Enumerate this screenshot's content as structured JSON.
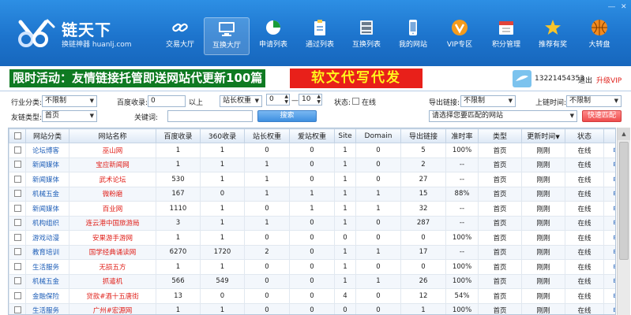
{
  "window": {
    "title": "链天下",
    "subtitle": "换链神器 huanlj.com",
    "minimize": "—",
    "close": "✕"
  },
  "nav": [
    {
      "label": "交易大厅",
      "icon": "link-chain-icon"
    },
    {
      "label": "互换大厅",
      "icon": "monitor-icon"
    },
    {
      "label": "申请列表",
      "icon": "pie-chart-icon"
    },
    {
      "label": "通过列表",
      "icon": "clipboard-icon"
    },
    {
      "label": "互换列表",
      "icon": "server-icon"
    },
    {
      "label": "我的网站",
      "icon": "phone-icon"
    },
    {
      "label": "VIP专区",
      "icon": "vip-icon"
    },
    {
      "label": "积分管理",
      "icon": "calendar-icon"
    },
    {
      "label": "推荐有奖",
      "icon": "star-icon"
    },
    {
      "label": "大转盘",
      "icon": "basketball-icon"
    }
  ],
  "banner": {
    "promo": "限时活动：友情链接托管即送网站代更新100篇",
    "ad": "软文代写代发",
    "phone": "13221454353",
    "logout": "退出",
    "vip": "升级VIP"
  },
  "filters": {
    "industry_label": "行业分类:",
    "industry_value": "不限制",
    "baidu_label": "百度收录:",
    "baidu_value": "0",
    "above_label": "以上",
    "weight_select": "站长权重",
    "weight_min": "0",
    "weight_dash": "—",
    "weight_max": "10",
    "status_label": "状态:",
    "online_label": "在线",
    "export_label": "导出链接:",
    "export_value": "不限制",
    "time_label": "上链时间:",
    "time_value": "不限制",
    "type_label": "友链类型:",
    "type_value": "首页",
    "keyword_label": "关键词:",
    "keyword_value": "",
    "search_button": "搜索",
    "site_placeholder": "请选择您要匹配的网站",
    "match_button": "快速匹配"
  },
  "table": {
    "headers": [
      "网站分类",
      "网站名称",
      "百度收录",
      "360收录",
      "站长权重",
      "爱站权重",
      "Site",
      "Domain",
      "导出链接",
      "准时率",
      "类型",
      "更新时间",
      "状态",
      "操作"
    ],
    "rows": [
      [
        "论坛博客",
        "巫山网",
        "1",
        "1",
        "0",
        "0",
        "1",
        "0",
        "5",
        "100%",
        "首页",
        "刚刚",
        "在线",
        "申请交换"
      ],
      [
        "新闻媒体",
        "宝应新闻网",
        "1",
        "1",
        "1",
        "0",
        "1",
        "0",
        "2",
        "--",
        "首页",
        "刚刚",
        "在线",
        "申请交换"
      ],
      [
        "新闻媒体",
        "武术论坛",
        "530",
        "1",
        "1",
        "0",
        "1",
        "0",
        "27",
        "--",
        "首页",
        "刚刚",
        "在线",
        "申请交换"
      ],
      [
        "机械五金",
        "微粉磨",
        "167",
        "0",
        "1",
        "1",
        "1",
        "1",
        "15",
        "88%",
        "首页",
        "刚刚",
        "在线",
        "申请交换"
      ],
      [
        "新闻媒体",
        "百业网",
        "1110",
        "1",
        "0",
        "1",
        "1",
        "1",
        "32",
        "--",
        "首页",
        "刚刚",
        "在线",
        "申请交换"
      ],
      [
        "机构组织",
        "连云港中国旅游局",
        "3",
        "1",
        "1",
        "0",
        "1",
        "0",
        "287",
        "--",
        "首页",
        "刚刚",
        "在线",
        "申请交换"
      ],
      [
        "游戏动漫",
        "安果游手游网",
        "1",
        "1",
        "0",
        "0",
        "0",
        "0",
        "0",
        "100%",
        "首页",
        "刚刚",
        "在线",
        "申请交换"
      ],
      [
        "教育培训",
        "国学经典诵读网",
        "6270",
        "1720",
        "2",
        "0",
        "1",
        "1",
        "17",
        "--",
        "首页",
        "刚刚",
        "在线",
        "申请交换"
      ],
      [
        "生活服务",
        "无损五方",
        "1",
        "1",
        "0",
        "0",
        "1",
        "0",
        "0",
        "100%",
        "首页",
        "刚刚",
        "在线",
        "申请交换"
      ],
      [
        "机械五金",
        "抓遣机",
        "566",
        "549",
        "0",
        "0",
        "1",
        "1",
        "26",
        "100%",
        "首页",
        "刚刚",
        "在线",
        "申请交换"
      ],
      [
        "金融保险",
        "贷款#酒十五唐街",
        "13",
        "0",
        "0",
        "0",
        "4",
        "0",
        "12",
        "54%",
        "首页",
        "刚刚",
        "在线",
        "申请交换"
      ],
      [
        "生活服务",
        "广州#宏源网",
        "1",
        "1",
        "0",
        "0",
        "0",
        "0",
        "1",
        "100%",
        "首页",
        "刚刚",
        "在线",
        "申请交换"
      ]
    ]
  }
}
